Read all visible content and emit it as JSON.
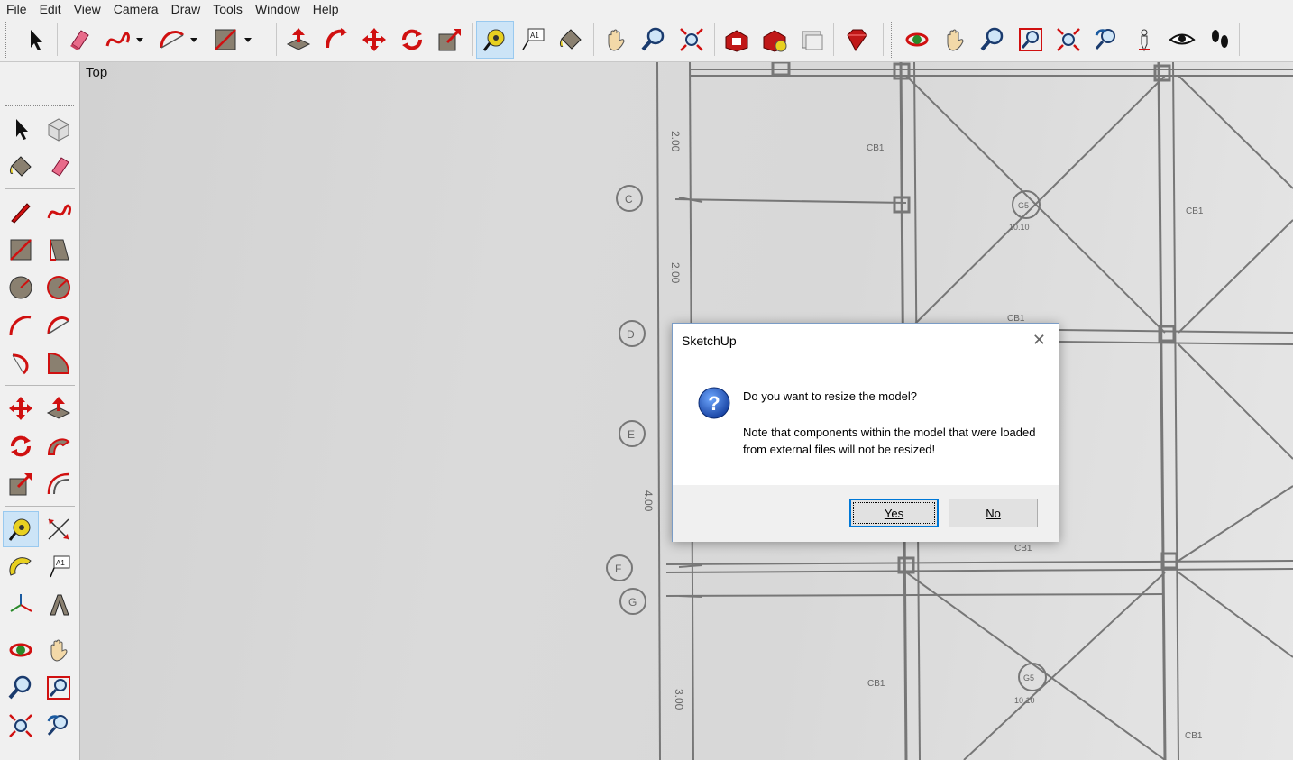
{
  "menu": [
    "File",
    "Edit",
    "View",
    "Camera",
    "Draw",
    "Tools",
    "Window",
    "Help"
  ],
  "viewport": {
    "scene_label": "Top"
  },
  "toolbar_icons": [
    "select-icon",
    "eraser-icon",
    "freehand-icon",
    "arc-icon",
    "rectangle-icon",
    "push-pull-icon",
    "follow-me-icon",
    "move-icon",
    "rotate-icon",
    "scale-icon",
    "tape-measure-icon",
    "text-icon",
    "paint-bucket-icon",
    "pan-icon",
    "zoom-icon",
    "zoom-extents-icon",
    "warehouse-icon",
    "extension-warehouse-icon",
    "layout-icon",
    "ruby-icon",
    "orbit-icon",
    "pan-icon",
    "zoom-icon",
    "zoom-window-icon",
    "zoom-extents-icon",
    "previous-view-icon",
    "position-camera-icon",
    "look-around-icon",
    "walk-icon"
  ],
  "plan_labels": {
    "grid_c": "C",
    "grid_d": "D",
    "grid_e": "E",
    "grid_f": "F",
    "grid_g": "G",
    "dim1": "2.00",
    "dim2": "2.00",
    "dim3": "4.00",
    "dim4": "3.00",
    "c1": "CB1",
    "c2": "CB1",
    "c3": "CB1",
    "c4": "CB1",
    "c5": "CB1",
    "c6": "CB1",
    "c7": "CB1",
    "g1": "G5",
    "g1b": "10.10",
    "g2": "G5",
    "g2b": "10.10"
  },
  "dialog": {
    "title": "SketchUp",
    "close_glyph": "✕",
    "question": "Do you want to resize the model?",
    "note": "Note that components within the model that were loaded from external files will not be resized!",
    "yes_label": "Yes",
    "no_label": "No",
    "icon": "question-icon"
  }
}
